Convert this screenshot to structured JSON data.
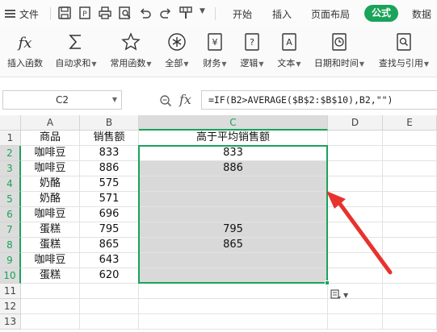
{
  "menubar": {
    "file_label": "文件",
    "tabs": [
      {
        "label": "开始",
        "active": false
      },
      {
        "label": "插入",
        "active": false
      },
      {
        "label": "页面布局",
        "active": false
      },
      {
        "label": "公式",
        "active": true
      },
      {
        "label": "数据",
        "active": false
      }
    ],
    "quick_access_icons": [
      "save-icon",
      "print-preview-icon",
      "print-icon",
      "preview-search-icon",
      "undo-icon",
      "redo-icon",
      "format-painter-icon",
      "more-dropdown-icon"
    ],
    "active_color": "#1aa35a"
  },
  "ribbon": {
    "buttons": [
      {
        "label": "插入函数",
        "dropdown": false,
        "icon": "fx-icon"
      },
      {
        "label": "自动求和",
        "dropdown": true,
        "icon": "sigma-icon"
      },
      {
        "label": "常用函数",
        "dropdown": true,
        "icon": "star-icon"
      },
      {
        "label": "全部",
        "dropdown": true,
        "icon": "asterisk-circle-icon"
      },
      {
        "label": "财务",
        "dropdown": true,
        "icon": "yen-book-icon"
      },
      {
        "label": "逻辑",
        "dropdown": true,
        "icon": "question-book-icon"
      },
      {
        "label": "文本",
        "dropdown": true,
        "icon": "text-book-icon"
      },
      {
        "label": "日期和时间",
        "dropdown": true,
        "icon": "clock-book-icon"
      },
      {
        "label": "查找与引用",
        "dropdown": true,
        "icon": "search-book-icon"
      }
    ]
  },
  "formula_bar": {
    "name_box": "C2",
    "fx": "fx",
    "formula": "=IF(B2>AVERAGE($B$2:$B$10),B2,\"\")"
  },
  "sheet": {
    "columns": [
      "A",
      "B",
      "C",
      "D",
      "E"
    ],
    "rows": [
      "1",
      "2",
      "3",
      "4",
      "5",
      "6",
      "7",
      "8",
      "9",
      "10",
      "11",
      "12",
      "13"
    ],
    "selected_column": "C",
    "selection": "C2:C10",
    "selection_color": "#1aa35a",
    "shade_color": "#d9d9d9",
    "header": [
      "商品",
      "销售额",
      "高于平均销售额"
    ],
    "data": [
      {
        "a": "咖啡豆",
        "b": "833",
        "c": "833"
      },
      {
        "a": "咖啡豆",
        "b": "886",
        "c": "886"
      },
      {
        "a": "奶酪",
        "b": "575",
        "c": ""
      },
      {
        "a": "奶酪",
        "b": "571",
        "c": ""
      },
      {
        "a": "咖啡豆",
        "b": "696",
        "c": ""
      },
      {
        "a": "蛋糕",
        "b": "795",
        "c": "795"
      },
      {
        "a": "蛋糕",
        "b": "865",
        "c": "865"
      },
      {
        "a": "咖啡豆",
        "b": "643",
        "c": ""
      },
      {
        "a": "蛋糕",
        "b": "620",
        "c": ""
      }
    ]
  },
  "annotation": {
    "arrow_color": "#e8322d"
  }
}
